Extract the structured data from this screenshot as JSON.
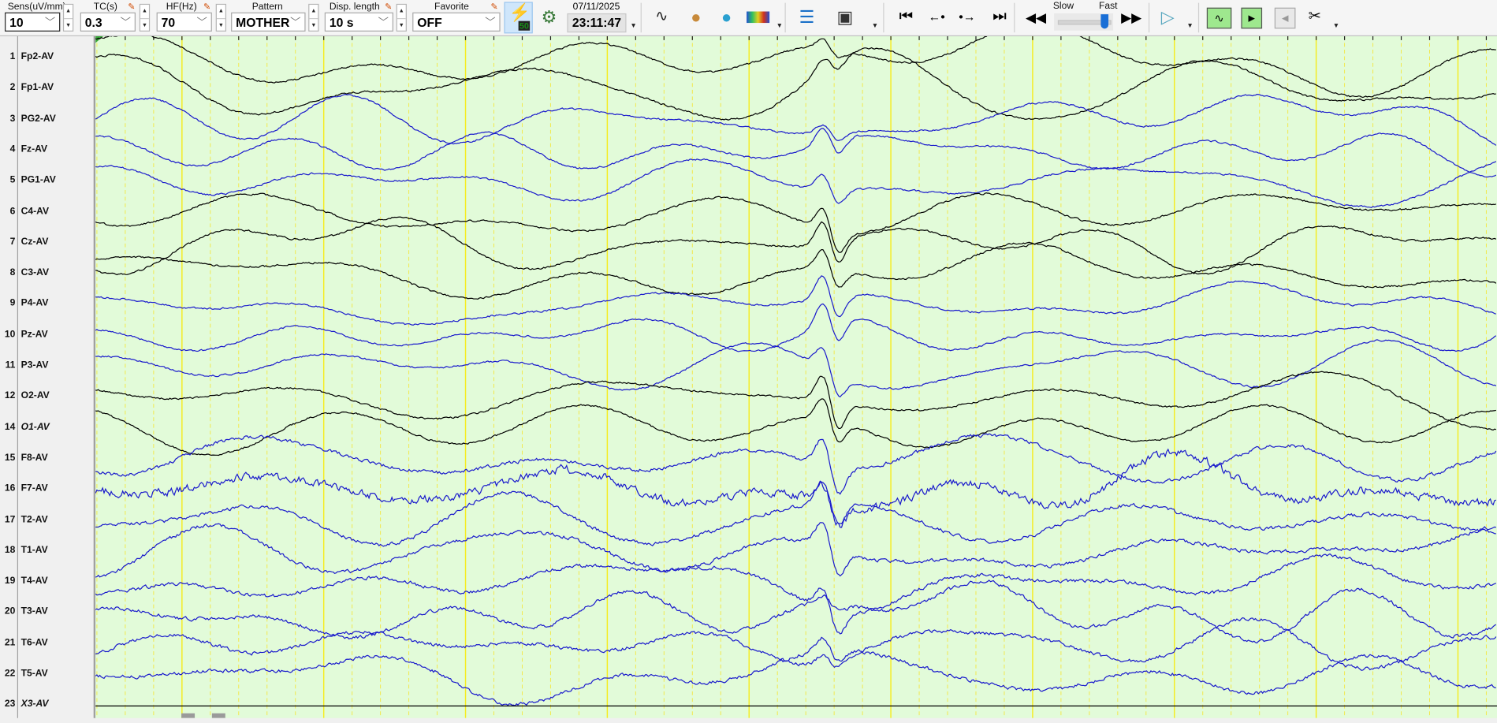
{
  "toolbar": {
    "sens": {
      "label": "Sens(uV/mm)",
      "value": "10"
    },
    "tc": {
      "label": "TC(s)",
      "value": "0.3"
    },
    "hf": {
      "label": "HF(Hz)",
      "value": "70"
    },
    "pattern": {
      "label": "Pattern",
      "value": "MOTHER"
    },
    "disp_length": {
      "label": "Disp. length",
      "value": "10 s"
    },
    "favorite": {
      "label": "Favorite",
      "value": "OFF"
    },
    "notch_badge": "50",
    "date": "07/11/2025",
    "time": "23:11:47",
    "speed": {
      "slow_label": "Slow",
      "fast_label": "Fast",
      "value": 1.0
    }
  },
  "channels": [
    {
      "num": "1",
      "label": "Fp2-AV",
      "color": "#000000"
    },
    {
      "num": "2",
      "label": "Fp1-AV",
      "color": "#000000"
    },
    {
      "num": "3",
      "label": "PG2-AV",
      "color": "#1a1acc"
    },
    {
      "num": "4",
      "label": "Fz-AV",
      "color": "#1a1acc"
    },
    {
      "num": "5",
      "label": "PG1-AV",
      "color": "#1a1acc"
    },
    {
      "num": "6",
      "label": "C4-AV",
      "color": "#000000"
    },
    {
      "num": "7",
      "label": "Cz-AV",
      "color": "#000000"
    },
    {
      "num": "8",
      "label": "C3-AV",
      "color": "#000000"
    },
    {
      "num": "9",
      "label": "P4-AV",
      "color": "#1a1acc"
    },
    {
      "num": "10",
      "label": "Pz-AV",
      "color": "#1a1acc"
    },
    {
      "num": "11",
      "label": "P3-AV",
      "color": "#1a1acc"
    },
    {
      "num": "12",
      "label": "O2-AV",
      "color": "#000000"
    },
    {
      "num": "14",
      "label": "O1-AV",
      "color": "#000000",
      "italic": true
    },
    {
      "num": "15",
      "label": "F8-AV",
      "color": "#1a1acc"
    },
    {
      "num": "16",
      "label": "F7-AV",
      "color": "#1a1acc"
    },
    {
      "num": "17",
      "label": "T2-AV",
      "color": "#1a1acc"
    },
    {
      "num": "18",
      "label": "T1-AV",
      "color": "#1a1acc"
    },
    {
      "num": "19",
      "label": "T4-AV",
      "color": "#1a1acc"
    },
    {
      "num": "20",
      "label": "T3-AV",
      "color": "#1a1acc"
    },
    {
      "num": "21",
      "label": "T6-AV",
      "color": "#1a1acc"
    },
    {
      "num": "22",
      "label": "T5-AV",
      "color": "#1a1acc"
    },
    {
      "num": "23",
      "label": "X3-AV",
      "color": "#000000",
      "italic": true,
      "flat": true
    }
  ],
  "colors": {
    "plot_bg": "#e2fbd9",
    "grid_minor": "#f2e84a",
    "grid_major": "#f5ec20"
  }
}
